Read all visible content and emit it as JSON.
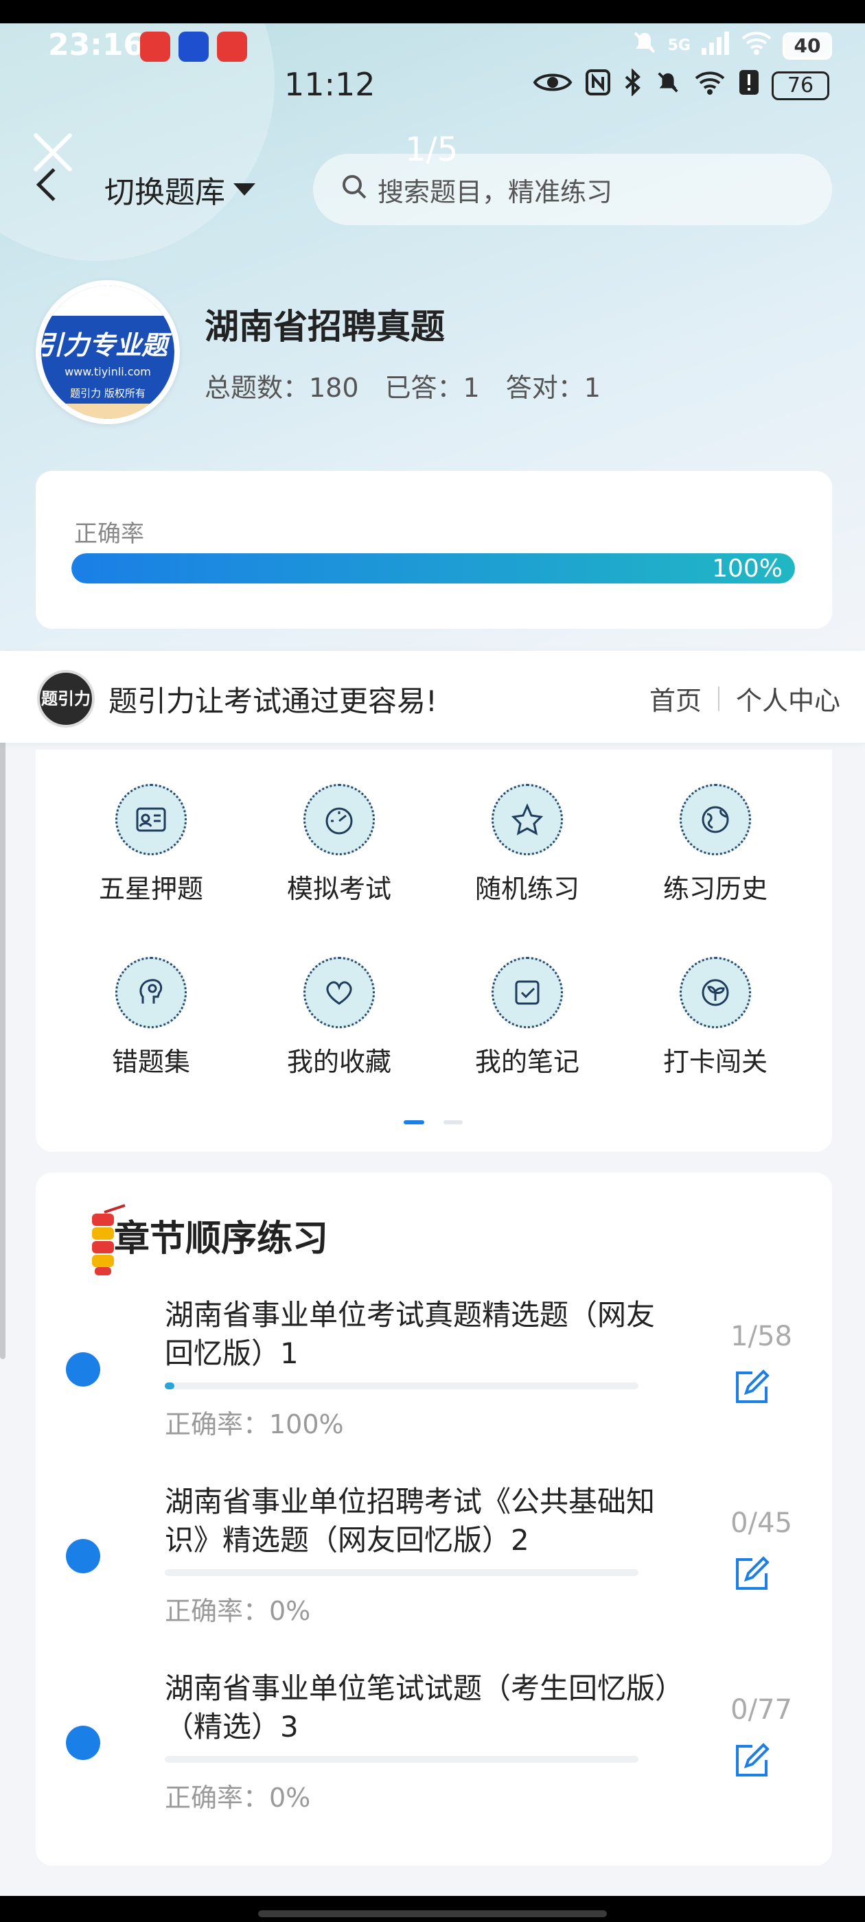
{
  "status_bar": {
    "time_primary": "23:16",
    "time_secondary": "11:12",
    "battery_primary": "40",
    "battery_secondary": "76",
    "network": "5G"
  },
  "header": {
    "pager": "1/5",
    "bank_switch": "切换题库",
    "search_placeholder": "搜索题目，精准练习"
  },
  "bank": {
    "logo_text": "引力专业题",
    "logo_url": "www.tiyinli.com",
    "logo_copyright": "题引力 版权所有",
    "title": "湖南省招聘真题",
    "stats": {
      "total": "总题数：180",
      "answered": "已答：1",
      "correct": "答对：1"
    }
  },
  "accuracy": {
    "label": "正确率",
    "percent_text": "100%",
    "value": 100
  },
  "banner": {
    "logo_text": "题引力",
    "slogan": "题引力让考试通过更容易!",
    "home": "首页",
    "personal": "个人中心"
  },
  "features": [
    {
      "label": "五星押题",
      "icon": "id-card-icon"
    },
    {
      "label": "模拟考试",
      "icon": "speedometer-icon"
    },
    {
      "label": "随机练习",
      "icon": "star-shuffle-icon"
    },
    {
      "label": "练习历史",
      "icon": "globe-icon"
    },
    {
      "label": "错题集",
      "icon": "head-icon"
    },
    {
      "label": "我的收藏",
      "icon": "heart-icon"
    },
    {
      "label": "我的笔记",
      "icon": "checkbox-icon"
    },
    {
      "label": "打卡闯关",
      "icon": "sprout-icon"
    }
  ],
  "chapters": {
    "title": "章节顺序练习",
    "items": [
      {
        "name": "湖南省事业单位考试真题精选题（网友回忆版）1",
        "accuracy": "正确率：100%",
        "count": "1/58",
        "progress": 0.017
      },
      {
        "name": "湖南省事业单位招聘考试《公共基础知识》精选题（网友回忆版）2",
        "accuracy": "正确率：0%",
        "count": "0/45",
        "progress": 0
      },
      {
        "name": "湖南省事业单位笔试试题（考生回忆版）（精选）3",
        "accuracy": "正确率：0%",
        "count": "0/77",
        "progress": 0
      }
    ]
  },
  "colors": {
    "accent": "#1a7fe6",
    "teal": "#21b7c4"
  }
}
